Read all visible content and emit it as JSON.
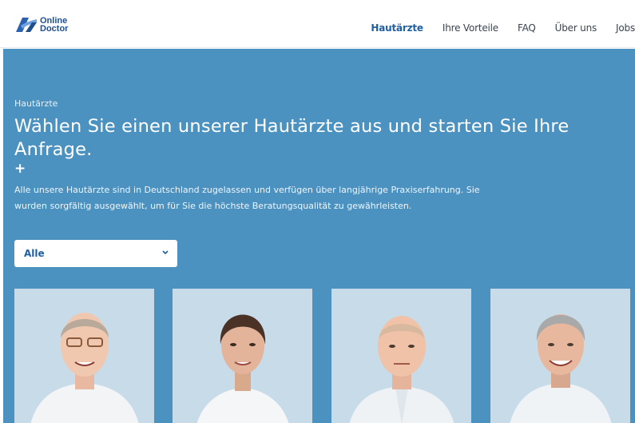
{
  "brand": {
    "line1": "Online",
    "line2": "Doctor"
  },
  "nav": {
    "items": [
      {
        "label": "Hautärzte",
        "active": true
      },
      {
        "label": "Ihre Vorteile",
        "active": false
      },
      {
        "label": "FAQ",
        "active": false
      },
      {
        "label": "Über uns",
        "active": false
      },
      {
        "label": "Jobs",
        "active": false
      }
    ]
  },
  "hero": {
    "breadcrumb": "Hautärzte",
    "title": "Wählen Sie einen unserer Hautärzte aus und starten Sie Ihre Anfrage.",
    "plus": "+",
    "description": "Alle unsere Hautärzte sind in Deutschland zugelassen und verfügen über langjährige Praxiserfahrung. Sie wurden sorgfältig ausgewählt, um für Sie die höchste Beratungsqualität zu gewährleisten."
  },
  "filter": {
    "selected": "Alle",
    "icon": "chevron-down-icon"
  },
  "doctors": [
    {
      "photo": "doctor-portrait-1",
      "hair": "#b8a99a",
      "glasses": true,
      "suit": "#f2f4f6"
    },
    {
      "photo": "doctor-portrait-2",
      "hair": "#4a3226",
      "glasses": false,
      "suit": "#f4f6f8"
    },
    {
      "photo": "doctor-portrait-3",
      "hair": "#d9b8a0",
      "glasses": false,
      "suit": "#eef2f5"
    },
    {
      "photo": "doctor-portrait-4",
      "hair": "#a9a9a9",
      "glasses": false,
      "suit": "#f0f3f6"
    }
  ],
  "colors": {
    "accent": "#1f5fa3",
    "hero_bg": "#4c92c0",
    "card_bg": "#c8dbe8"
  }
}
